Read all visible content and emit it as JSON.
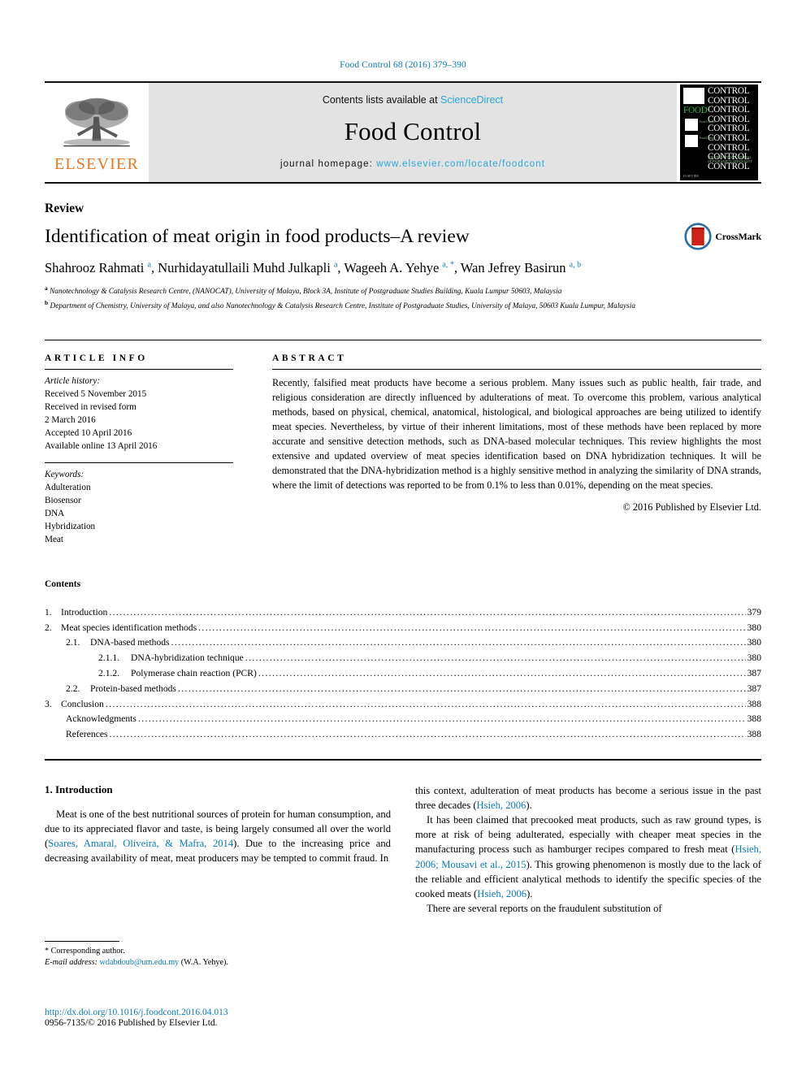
{
  "running_head": "Food Control 68 (2016) 379–390",
  "masthead": {
    "publisher_name": "ELSEVIER",
    "contents_prefix": "Contents lists available at ",
    "contents_link": "ScienceDirect",
    "journal_title": "Food Control",
    "homepage_prefix": "journal homepage: ",
    "homepage_link": "www.elsevier.com/locate/foodcont",
    "cover": {
      "repeat_word": "CONTROL",
      "repeat_count": 9,
      "accent_word": "FOOD",
      "accent_color": "#2bbf4b",
      "caption": "THE INTERNATIONAL JOURNAL OF FOOD SAFETY AND QUALITY",
      "publisher_footer": "ELSEVIER"
    }
  },
  "article": {
    "type_label": "Review",
    "title": "Identification of meat origin in food products–A review",
    "crossmark_label": "CrossMark",
    "authors": [
      {
        "name": "Shahrooz Rahmati",
        "marks": "a",
        "sep": ", "
      },
      {
        "name": "Nurhidayatullaili Muhd Julkapli",
        "marks": "a",
        "sep": ", "
      },
      {
        "name": "Wageeh A. Yehye",
        "marks": "a, *",
        "sep": ", "
      },
      {
        "name": "Wan Jefrey Basirun",
        "marks": "a, b",
        "sep": ""
      }
    ],
    "affiliations": [
      {
        "mark": "a",
        "text": "Nanotechnology & Catalysis Research Centre, (NANOCAT), University of Malaya, Block 3A, Institute of Postgraduate Studies Building, Kuala Lumpur 50603, Malaysia"
      },
      {
        "mark": "b",
        "text": "Department of Chemistry, University of Malaya, and also Nanotechnology & Catalysis Research Centre, Institute of Postgraduate Studies, University of Malaya, 50603 Kuala Lumpur, Malaysia"
      }
    ]
  },
  "article_info": {
    "heading": "ARTICLE INFO",
    "history_label": "Article history:",
    "history": [
      "Received 5 November 2015",
      "Received in revised form",
      "2 March 2016",
      "Accepted 10 April 2016",
      "Available online 13 April 2016"
    ],
    "keywords_label": "Keywords:",
    "keywords": [
      "Adulteration",
      "Biosensor",
      "DNA",
      "Hybridization",
      "Meat"
    ]
  },
  "abstract": {
    "heading": "ABSTRACT",
    "text": "Recently, falsified meat products have become a serious problem. Many issues such as public health, fair trade, and religious consideration are directly influenced by adulterations of meat. To overcome this problem, various analytical methods, based on physical, chemical, anatomical, histological, and biological approaches are being utilized to identify meat species. Nevertheless, by virtue of their inherent limitations, most of these methods have been replaced by more accurate and sensitive detection methods, such as DNA-based molecular techniques. This review highlights the most extensive and updated overview of meat species identification based on DNA hybridization techniques. It will be demonstrated that the DNA-hybridization method is a highly sensitive method in analyzing the similarity of DNA strands, where the limit of detections was reported to be from 0.1% to less than 0.01%, depending on the meat species.",
    "copyright": "© 2016 Published by Elsevier Ltd."
  },
  "contents": {
    "heading": "Contents",
    "items": [
      {
        "level": 1,
        "number": "1.",
        "label": "Introduction",
        "page": "379"
      },
      {
        "level": 1,
        "number": "2.",
        "label": "Meat species identification methods",
        "page": "380"
      },
      {
        "level": 2,
        "number": "2.1.",
        "label": "DNA-based methods",
        "page": "380"
      },
      {
        "level": 3,
        "number": "2.1.1.",
        "label": "DNA-hybridization technique",
        "page": "380"
      },
      {
        "level": 3,
        "number": "2.1.2.",
        "label": "Polymerase chain reaction (PCR)",
        "page": "387"
      },
      {
        "level": 2,
        "number": "2.2.",
        "label": "Protein-based methods",
        "page": "387"
      },
      {
        "level": 1,
        "number": "3.",
        "label": "Conclusion",
        "page": "388"
      },
      {
        "level": 4,
        "number": "",
        "label": "Acknowledgments",
        "page": "388"
      },
      {
        "level": 4,
        "number": "",
        "label": "References",
        "page": "388"
      }
    ]
  },
  "body": {
    "section_heading": "1. Introduction",
    "left_paragraphs": [
      {
        "parts": [
          {
            "t": "Meat is one of the best nutritional sources of protein for human consumption, and due to its appreciated flavor and taste, is being largely consumed all over the world (",
            "link": false
          },
          {
            "t": "Soares, Amaral, Oliveira, & Mafra, 2014",
            "link": true
          },
          {
            "t": "). Due to the increasing price and decreasing availability of meat, meat producers may be tempted to commit fraud. In",
            "link": false
          }
        ]
      }
    ],
    "right_paragraphs": [
      {
        "indent": false,
        "parts": [
          {
            "t": "this context, adulteration of meat products has become a serious issue in the past three decades (",
            "link": false
          },
          {
            "t": "Hsieh, 2006",
            "link": true
          },
          {
            "t": ").",
            "link": false
          }
        ]
      },
      {
        "indent": true,
        "parts": [
          {
            "t": "It has been claimed that precooked meat products, such as raw ground types, is more at risk of being adulterated, especially with cheaper meat species in the manufacturing process such as hamburger recipes compared to fresh meat (",
            "link": false
          },
          {
            "t": "Hsieh, 2006; Mousavi et al., 2015",
            "link": true
          },
          {
            "t": "). This growing phenomenon is mostly due to the lack of the reliable and efficient analytical methods to identify the specific species of the cooked meats (",
            "link": false
          },
          {
            "t": "Hsieh, 2006",
            "link": true
          },
          {
            "t": ").",
            "link": false
          }
        ]
      },
      {
        "indent": true,
        "parts": [
          {
            "t": "There are several reports on the fraudulent substitution of",
            "link": false
          }
        ]
      }
    ]
  },
  "footer": {
    "corresponding_marker": "*",
    "corresponding_label": "Corresponding author.",
    "email_label": "E-mail address:",
    "email": "wdabdoub@um.edu.my",
    "email_owner": "(W.A. Yehye).",
    "doi": "http://dx.doi.org/10.1016/j.foodcont.2016.04.013",
    "issn_line": "0956-7135/© 2016 Published by Elsevier Ltd."
  },
  "colors": {
    "link": "#0b7bb5",
    "link_light": "#2ba6d9",
    "elsevier_orange": "#E87722",
    "masthead_bg": "#e3e3e3"
  }
}
